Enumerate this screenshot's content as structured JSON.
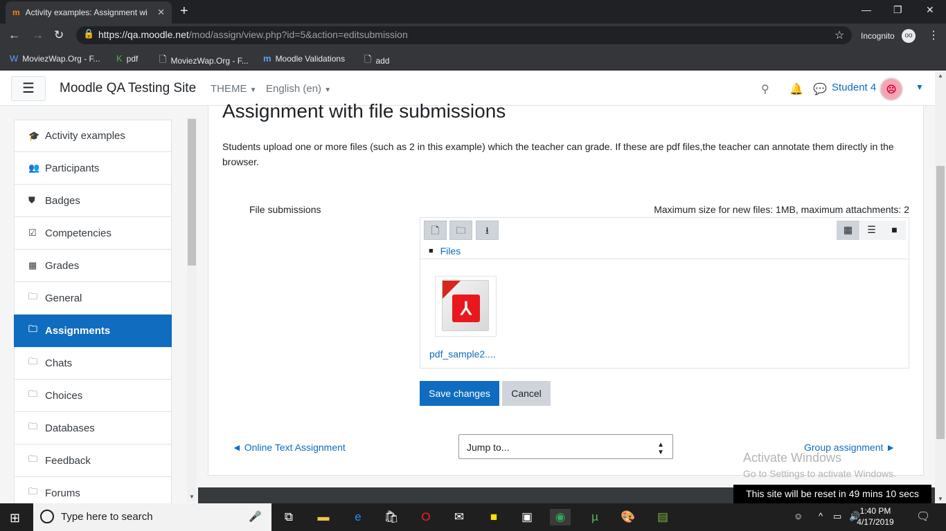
{
  "browser": {
    "tab_title": "Activity examples: Assignment wi",
    "tab_favicon": "m",
    "url_host": "https://qa.moodle.net",
    "url_path": "/mod/assign/view.php?id=5&action=editsubmission",
    "incognito_label": "Incognito",
    "bookmarks": [
      {
        "label": "MoviezWap.Org - F...",
        "icon": "W"
      },
      {
        "label": "pdf",
        "icon": "K"
      },
      {
        "label": "MoviezWap.Org - F...",
        "icon": "doc"
      },
      {
        "label": "Moodle Validations",
        "icon": "m"
      },
      {
        "label": "add",
        "icon": "doc"
      }
    ]
  },
  "navbar": {
    "site_name": "Moodle QA Testing Site",
    "theme_label": "THEME",
    "language_label": "English (en)",
    "user_name": "Student 4"
  },
  "drawer": {
    "items": [
      {
        "label": "Activity examples",
        "icon": "graduation-cap-icon"
      },
      {
        "label": "Participants",
        "icon": "users-icon"
      },
      {
        "label": "Badges",
        "icon": "shield-icon"
      },
      {
        "label": "Competencies",
        "icon": "checkbox-icon"
      },
      {
        "label": "Grades",
        "icon": "table-icon"
      },
      {
        "label": "General",
        "icon": "folder-icon"
      },
      {
        "label": "Assignments",
        "icon": "folder-icon",
        "active": true
      },
      {
        "label": "Chats",
        "icon": "folder-icon"
      },
      {
        "label": "Choices",
        "icon": "folder-icon"
      },
      {
        "label": "Databases",
        "icon": "folder-icon"
      },
      {
        "label": "Feedback",
        "icon": "folder-icon"
      },
      {
        "label": "Forums",
        "icon": "folder-icon"
      }
    ]
  },
  "main": {
    "heading": "Assignment with file submissions",
    "intro": "Students upload one or more files (such as 2 in this example) which the teacher can grade. If these are pdf files,the teacher can annotate them directly in the browser.",
    "field_label": "File submissions",
    "max_size_text": "Maximum size for new files: 1MB, maximum attachments: 2",
    "filemanager": {
      "path_label": "Files",
      "files": [
        {
          "name": "pdf_sample2....",
          "type": "pdf"
        }
      ]
    },
    "save_label": "Save changes",
    "cancel_label": "Cancel",
    "prev_activity": "◄ Online Text Assignment",
    "jump_to": "Jump to...",
    "next_activity": "Group assignment ►"
  },
  "overlay": {
    "activate_title": "Activate Windows",
    "activate_sub": "Go to Settings to activate Windows.",
    "reset_notice": "This site will be reset in 49 mins 10 secs"
  },
  "taskbar": {
    "search_placeholder": "Type here to search",
    "time": "1:40 PM",
    "date": "4/17/2019"
  }
}
